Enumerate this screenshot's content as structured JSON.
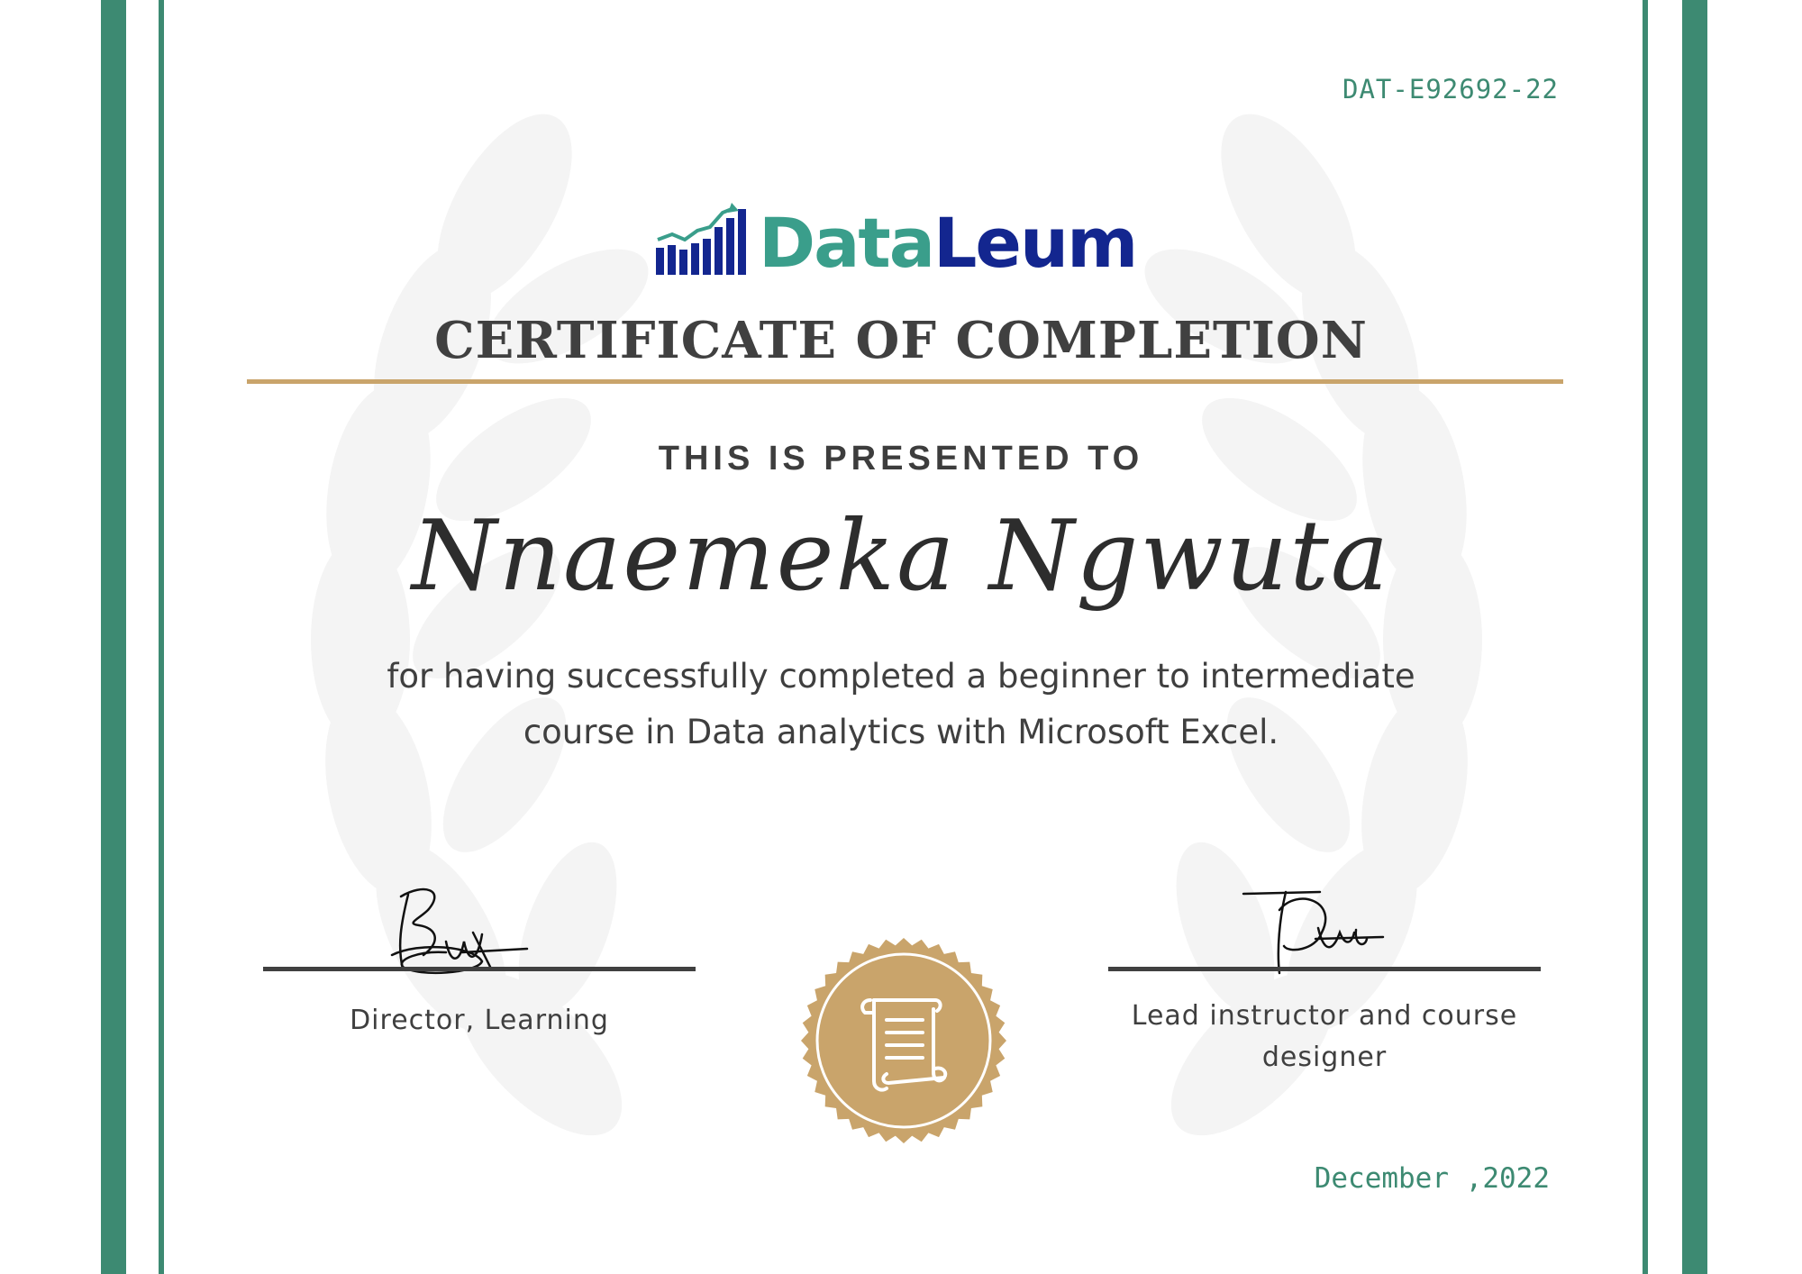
{
  "certificate": {
    "id": "DAT-E92692-22",
    "brand": {
      "part1": "Data",
      "part2": "Leum"
    },
    "title": "CERTIFICATE OF COMPLETION",
    "presented_to": "THIS IS PRESENTED TO",
    "recipient": "Nnaemeka Ngwuta",
    "description_line1": "for having successfully completed a beginner to intermediate",
    "description_line2": "course in Data analytics with Microsoft Excel.",
    "signatory_left": "Director, Learning",
    "signatory_right_line1": "Lead instructor and course",
    "signatory_right_line2": "designer",
    "date": "December ,2022"
  },
  "colors": {
    "border": "#3d8a72",
    "rule": "#c9a46b",
    "seal": "#c9a46b",
    "logo_data": "#3a9e8b",
    "logo_leum": "#13268f",
    "text": "#404040"
  },
  "icons": {
    "logo": "bar-chart-trend-icon",
    "seal": "scroll-icon"
  }
}
